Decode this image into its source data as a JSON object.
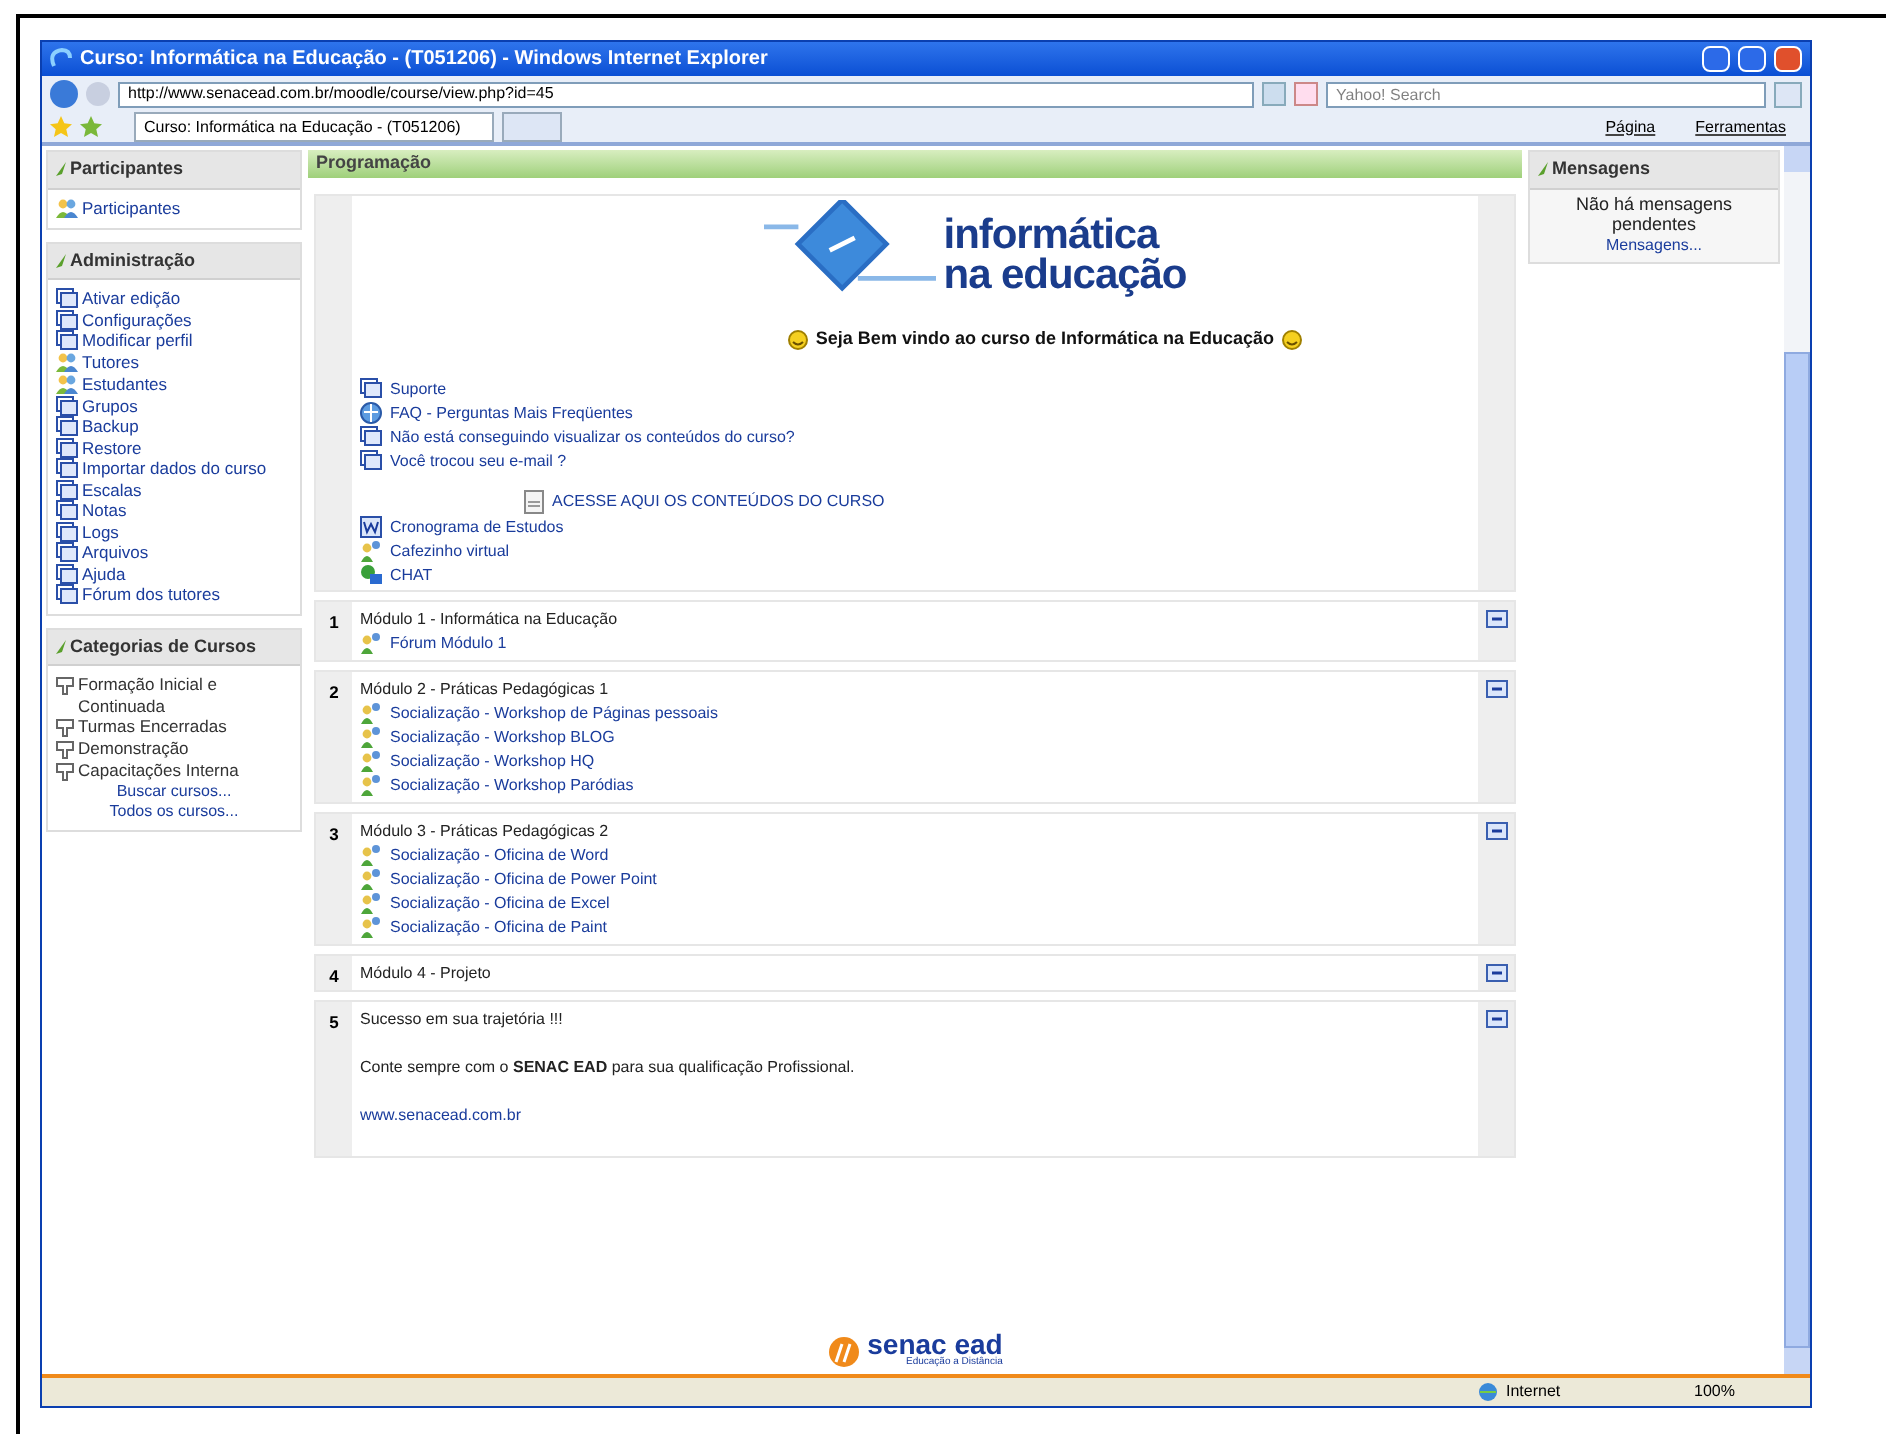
{
  "window": {
    "title": "Curso: Informática na Educação - (T051206) - Windows Internet Explorer",
    "address": "http://www.senacead.com.br/moodle/course/view.php?id=45",
    "search_placeholder": "Yahoo! Search",
    "tab": "Curso: Informática na Educação - (T051206)",
    "toolbar": [
      "Página",
      "Ferramentas"
    ]
  },
  "left_blocks": [
    {
      "title": "Participantes",
      "items": [
        "Participantes"
      ]
    },
    {
      "title": "Administração",
      "items": [
        "Ativar edição",
        "Configurações",
        "Modificar perfil",
        "Tutores",
        "Estudantes",
        "Grupos",
        "Backup",
        "Restore",
        "Importar dados do curso",
        "Escalas",
        "Notas",
        "Logs",
        "Arquivos",
        "Ajuda",
        "Fórum dos tutores"
      ]
    },
    {
      "title": "Categorias de Cursos",
      "items": [
        "Formação Inicial e Continuada",
        "Turmas Encerradas",
        "Demonstração",
        "Capacitações Interna"
      ],
      "links": [
        "Buscar cursos...",
        "Todos os cursos..."
      ]
    }
  ],
  "main": {
    "title": "Programação",
    "logo": [
      "informática",
      "na educação"
    ],
    "welcome": "Seja Bem vindo ao curso de Informática na Educação",
    "links": [
      {
        "kind": "page",
        "label": "Suporte"
      },
      {
        "kind": "url",
        "label": "FAQ - Perguntas Mais Freqüentes"
      },
      {
        "kind": "page",
        "label": "Não está conseguindo visualizar os conteúdos do curso?"
      },
      {
        "kind": "page",
        "label": "Você trocou seu e-mail ?"
      },
      {
        "kind": "file",
        "label": "ACESSE AQUI OS CONTEÚDOS DO CURSO"
      },
      {
        "kind": "word",
        "label": "Cronograma de Estudos"
      },
      {
        "kind": "forum",
        "label": "Cafezinho virtual"
      },
      {
        "kind": "chat",
        "label": "CHAT"
      }
    ],
    "sections": [
      {
        "number": "1",
        "title": "Módulo 1 - Informática na Educação",
        "activities": [
          "Fórum Módulo 1"
        ]
      },
      {
        "number": "2",
        "title": "Módulo 2 - Práticas Pedagógicas 1",
        "activities": [
          "Socialização - Workshop de Páginas pessoais",
          "Socialização - Workshop BLOG",
          "Socialização - Workshop HQ",
          "Socialização - Workshop Paródias"
        ]
      },
      {
        "number": "3",
        "title": "Módulo 3 - Práticas Pedagógicas 2",
        "activities": [
          "Socialização - Oficina de Word",
          "Socialização - Oficina de Power Point",
          "Socialização - Oficina de Excel",
          "Socialização - Oficina de Paint"
        ]
      },
      {
        "number": "4",
        "title": "Módulo 4 - Projeto"
      },
      {
        "number": "5",
        "title": "Sucesso em sua trajetória !!!",
        "paragraph": "Conte sempre com o **SENAC EAD** para sua qualificação Profissional.",
        "link": "www.senacead.com.br"
      }
    ]
  },
  "right_block": {
    "title": "Mensagens",
    "text": "Não há mensagens pendentes",
    "link": "Mensagens..."
  },
  "footer_logo": {
    "name": "senac ead",
    "tagline": "Educação a Distância"
  },
  "status_bar": {
    "zone": "Internet",
    "zoom": "100%"
  }
}
